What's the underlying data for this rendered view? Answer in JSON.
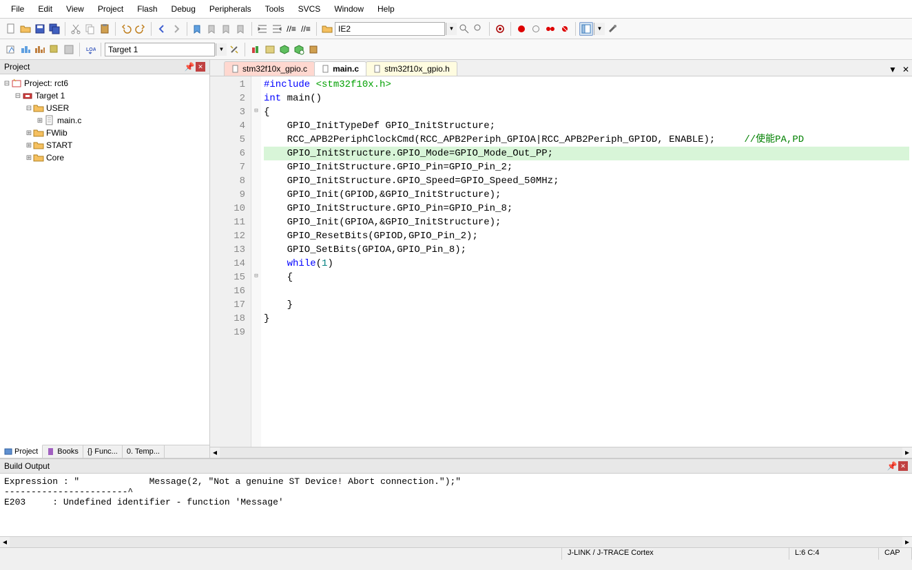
{
  "menu": [
    "File",
    "Edit",
    "View",
    "Project",
    "Flash",
    "Debug",
    "Peripherals",
    "Tools",
    "SVCS",
    "Window",
    "Help"
  ],
  "toolbar1": {
    "ie2_text": "IE2"
  },
  "toolbar2": {
    "target_text": "Target 1"
  },
  "project_panel": {
    "title": "Project",
    "root": "Project: rct6",
    "target": "Target 1",
    "folders": [
      {
        "name": "USER",
        "expanded": true,
        "files": [
          "main.c"
        ]
      },
      {
        "name": "FWlib",
        "expanded": false,
        "files": []
      },
      {
        "name": "START",
        "expanded": false,
        "files": []
      },
      {
        "name": "Core",
        "expanded": false,
        "files": []
      }
    ],
    "bottom_tabs": [
      "Project",
      "Books",
      "{} Func...",
      "0. Temp..."
    ]
  },
  "editor": {
    "tabs": [
      {
        "label": "stm32f10x_gpio.c",
        "state": "modified"
      },
      {
        "label": "main.c",
        "state": "active"
      },
      {
        "label": "stm32f10x_gpio.h",
        "state": "header"
      }
    ],
    "lines": [
      {
        "n": 1,
        "html": "<span class='kw'>#include</span> <span class='inc'>&lt;stm32f10x.h&gt;</span>"
      },
      {
        "n": 2,
        "html": "<span class='kw'>int</span> main()"
      },
      {
        "n": 3,
        "html": "{",
        "fold": "-"
      },
      {
        "n": 4,
        "html": "    GPIO_InitTypeDef GPIO_InitStructure;"
      },
      {
        "n": 5,
        "html": "    RCC_APB2PeriphClockCmd(RCC_APB2Periph_GPIOA|RCC_APB2Periph_GPIOD, ENABLE);     <span class='cmt'>//使能PA,PD</span>"
      },
      {
        "n": 6,
        "html": "    GPIO_InitStructure.GPIO_Mode=GPIO_Mode_Out_PP;",
        "hl": true
      },
      {
        "n": 7,
        "html": "    GPIO_InitStructure.GPIO_Pin=GPIO_Pin_2;"
      },
      {
        "n": 8,
        "html": "    GPIO_InitStructure.GPIO_Speed=GPIO_Speed_50MHz;"
      },
      {
        "n": 9,
        "html": "    GPIO_Init(GPIOD,&amp;GPIO_InitStructure);"
      },
      {
        "n": 10,
        "html": "    GPIO_InitStructure.GPIO_Pin=GPIO_Pin_8;"
      },
      {
        "n": 11,
        "html": "    GPIO_Init(GPIOA,&amp;GPIO_InitStructure);"
      },
      {
        "n": 12,
        "html": "    GPIO_ResetBits(GPIOD,GPIO_Pin_2);"
      },
      {
        "n": 13,
        "html": "    GPIO_SetBits(GPIOA,GPIO_Pin_8);"
      },
      {
        "n": 14,
        "html": "    <span class='kw'>while</span>(<span class='num'>1</span>)"
      },
      {
        "n": 15,
        "html": "    {",
        "fold": "-"
      },
      {
        "n": 16,
        "html": ""
      },
      {
        "n": 17,
        "html": "    }"
      },
      {
        "n": 18,
        "html": "}"
      },
      {
        "n": 19,
        "html": ""
      }
    ]
  },
  "build": {
    "title": "Build Output",
    "text": "Expression : \"             Message(2, \"Not a genuine ST Device! Abort connection.\");\"\n-----------------------^\nE203     : Undefined identifier - function 'Message'"
  },
  "status": {
    "debugger": "J-LINK / J-TRACE Cortex",
    "pos": "L:6 C:4",
    "cap": "CAP"
  }
}
